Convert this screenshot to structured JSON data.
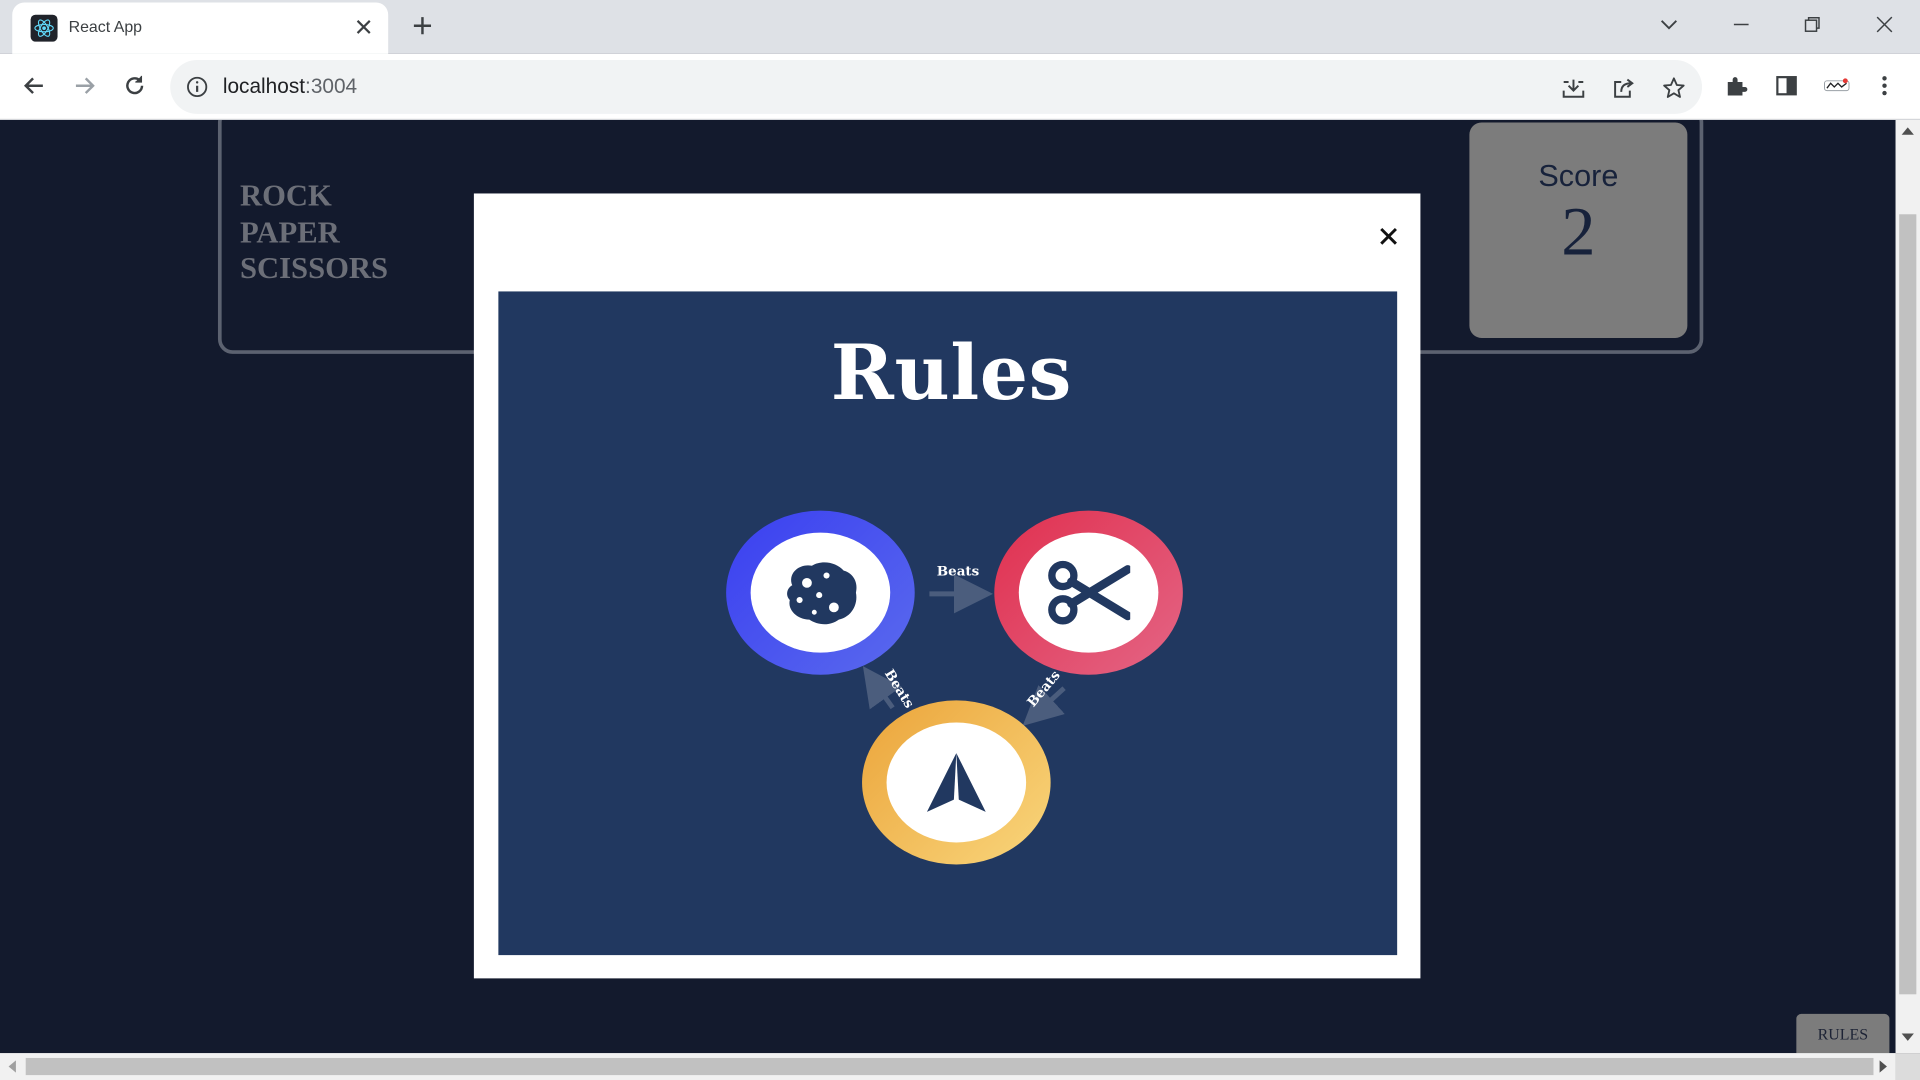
{
  "browser": {
    "tab_title": "React App",
    "url_host": "localhost",
    "url_port": ":3004"
  },
  "game": {
    "title_lines": [
      "ROCK",
      "PAPER",
      "SCISSORS"
    ],
    "score_label": "Score",
    "score_value": "2",
    "rules_button": "RULES"
  },
  "modal": {
    "close_icon": "close-icon",
    "heading": "Rules",
    "beats_label": "Beats",
    "tokens": [
      "rock",
      "scissors",
      "paper"
    ],
    "colors": {
      "rock": "#4651f0",
      "scissors": "#e0395a",
      "paper": "#f1bd45",
      "background": "#213860"
    }
  }
}
